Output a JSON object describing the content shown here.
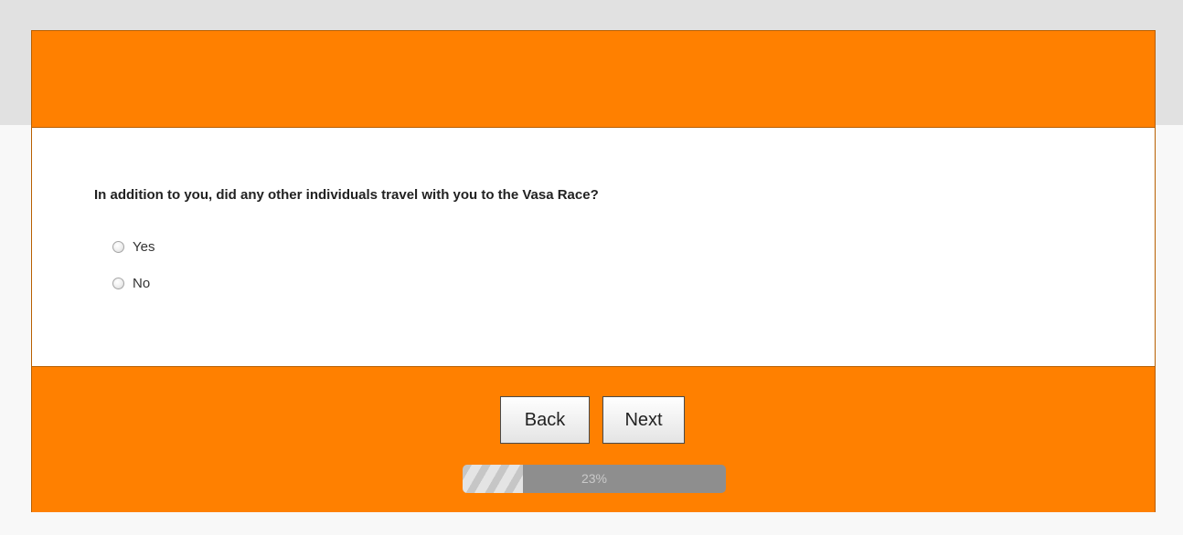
{
  "question": {
    "text": "In addition to you, did any other individuals travel with you to the Vasa Race?",
    "options": [
      {
        "label": "Yes",
        "selected": false
      },
      {
        "label": "No",
        "selected": false
      }
    ]
  },
  "navigation": {
    "back_label": "Back",
    "next_label": "Next"
  },
  "progress": {
    "percent": 23,
    "label": "23%"
  },
  "colors": {
    "brand": "#ff8000",
    "page_background": "#f8f8f8"
  }
}
